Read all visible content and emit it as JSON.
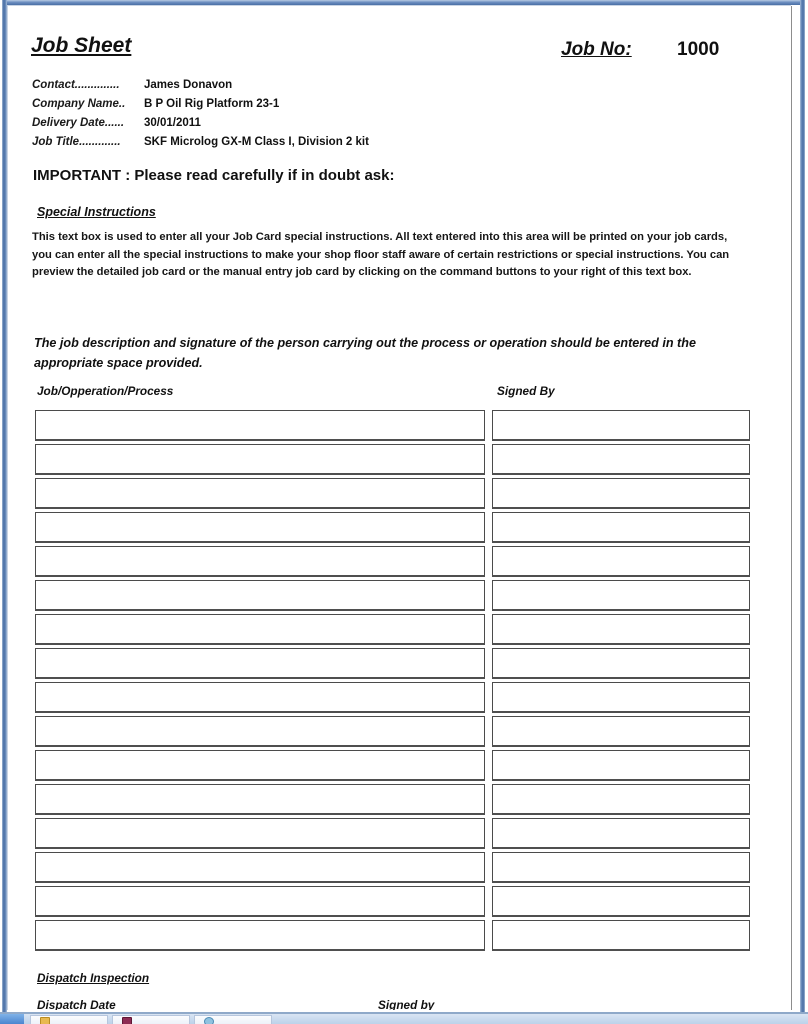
{
  "document": {
    "title": "Job Sheet",
    "job_no_label": "Job No:",
    "job_no_value": "1000"
  },
  "meta": {
    "rows": [
      {
        "label": "Contact..............",
        "value": "James Donavon"
      },
      {
        "label": "Company Name..",
        "value": "B P Oil Rig Platform 23-1"
      },
      {
        "label": "Delivery Date......",
        "value": "30/01/2011"
      },
      {
        "label": "Job Title.............",
        "value": "SKF Microlog GX-M Class I, Division 2 kit"
      }
    ]
  },
  "notice": {
    "important": "IMPORTANT : Please read carefully if in doubt ask:"
  },
  "special_instructions": {
    "heading": "Special Instructions",
    "body": "This text box is used to enter all your Job Card special instructions. All text entered into this area will be printed on your job cards, you can enter all the special instructions to make your shop floor staff aware of certain restrictions or special instructions. You can preview the detailed job card or the manual entry job card by clicking on the command buttons to your right of this text box."
  },
  "job_description": {
    "note": "The job description and signature of the person carrying out the process or operation should be entered in the appropriate space provided.",
    "column_headers": {
      "left": "Job/Opperation/Process",
      "right": "Signed By"
    },
    "rows": [
      {
        "job": "",
        "signed_by": ""
      },
      {
        "job": "",
        "signed_by": ""
      },
      {
        "job": "",
        "signed_by": ""
      },
      {
        "job": "",
        "signed_by": ""
      },
      {
        "job": "",
        "signed_by": ""
      },
      {
        "job": "",
        "signed_by": ""
      },
      {
        "job": "",
        "signed_by": ""
      },
      {
        "job": "",
        "signed_by": ""
      },
      {
        "job": "",
        "signed_by": ""
      },
      {
        "job": "",
        "signed_by": ""
      },
      {
        "job": "",
        "signed_by": ""
      },
      {
        "job": "",
        "signed_by": ""
      },
      {
        "job": "",
        "signed_by": ""
      },
      {
        "job": "",
        "signed_by": ""
      },
      {
        "job": "",
        "signed_by": ""
      },
      {
        "job": "",
        "signed_by": ""
      }
    ]
  },
  "dispatch": {
    "heading": "Dispatch Inspection",
    "date_label": "Dispatch Date",
    "signed_label": "Signed by"
  },
  "colors": {
    "window_border": "#4a6fa5",
    "cell_border": "#4b4b4b",
    "text": "#111111",
    "taskbar": "#bcd2ea"
  }
}
